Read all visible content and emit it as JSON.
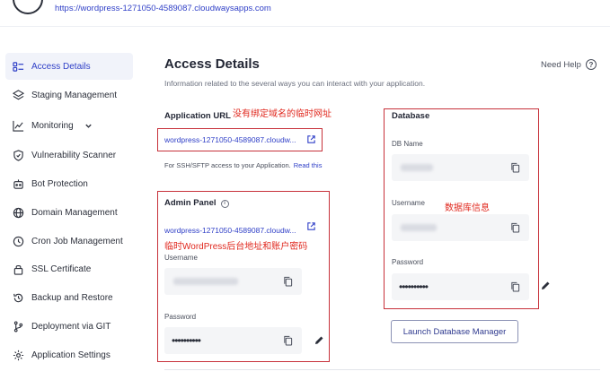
{
  "header": {
    "app_url": "https://wordpress-1271050-4589087.cloudwaysapps.com"
  },
  "sidebar": {
    "items": [
      {
        "label": "Access Details",
        "icon": "access-details-icon"
      },
      {
        "label": "Staging Management",
        "icon": "staging-icon"
      },
      {
        "label": "Monitoring",
        "icon": "monitoring-icon"
      },
      {
        "label": "Vulnerability Scanner",
        "icon": "shield-icon"
      },
      {
        "label": "Bot Protection",
        "icon": "bot-icon"
      },
      {
        "label": "Domain Management",
        "icon": "globe-icon"
      },
      {
        "label": "Cron Job Management",
        "icon": "clock-icon"
      },
      {
        "label": "SSL Certificate",
        "icon": "lock-icon"
      },
      {
        "label": "Backup and Restore",
        "icon": "backup-icon"
      },
      {
        "label": "Deployment via GIT",
        "icon": "git-icon"
      },
      {
        "label": "Application Settings",
        "icon": "gear-icon"
      }
    ]
  },
  "main": {
    "title": "Access Details",
    "subtitle": "Information related to the several ways you can interact with your application.",
    "help_label": "Need Help",
    "app_url_section": {
      "label": "Application URL",
      "annotation": "没有绑定域名的临时网址",
      "url": "wordpress-1271050-4589087.cloudw...",
      "note": "For SSH/SFTP access to your Application.",
      "read_this": "Read this"
    },
    "admin_panel": {
      "label": "Admin Panel",
      "url": "wordpress-1271050-4589087.cloudw...",
      "annotation": "临时WordPress后台地址和账户密码",
      "username_label": "Username",
      "password_label": "Password",
      "password_mask": "••••••••••"
    },
    "database": {
      "label": "Database",
      "annotation": "数据库信息",
      "db_name_label": "DB Name",
      "username_label": "Username",
      "password_label": "Password",
      "password_mask": "••••••••••",
      "launch_button": "Launch Database Manager"
    }
  },
  "colors": {
    "accent": "#2f3fc7",
    "annotation": "#e0281e",
    "highlight_box": "#c7313a"
  }
}
